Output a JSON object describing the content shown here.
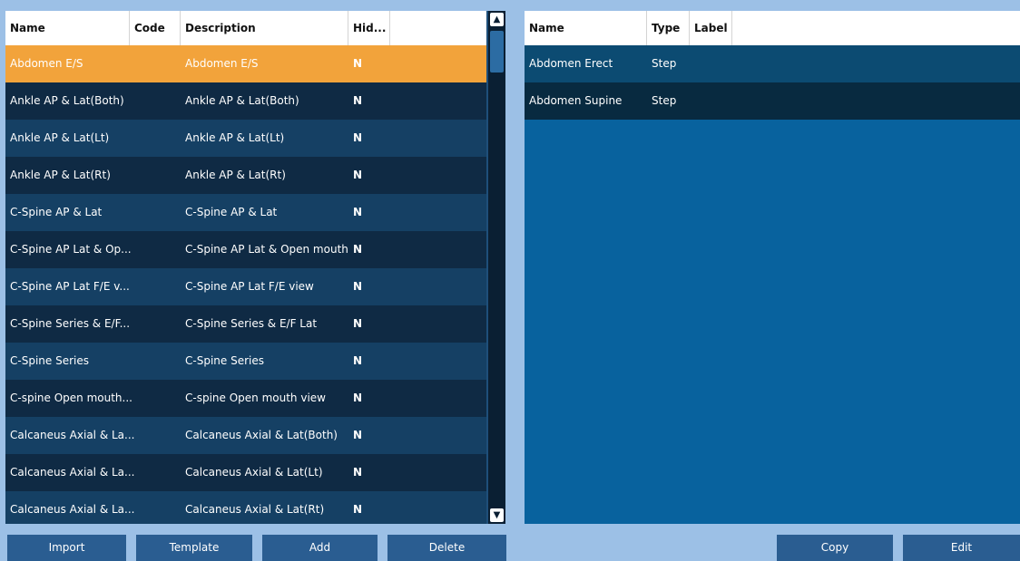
{
  "left_table": {
    "columns": [
      "Name",
      "Code",
      "Description",
      "Hid..."
    ],
    "rows": [
      {
        "name": "Abdomen E/S",
        "code": "",
        "description": "Abdomen E/S",
        "hidden": "N"
      },
      {
        "name": "Ankle AP & Lat(Both)",
        "code": "",
        "description": "Ankle AP & Lat(Both)",
        "hidden": "N"
      },
      {
        "name": "Ankle AP & Lat(Lt)",
        "code": "",
        "description": "Ankle AP & Lat(Lt)",
        "hidden": "N"
      },
      {
        "name": "Ankle AP & Lat(Rt)",
        "code": "",
        "description": "Ankle AP & Lat(Rt)",
        "hidden": "N"
      },
      {
        "name": "C-Spine AP & Lat",
        "code": "",
        "description": "C-Spine AP & Lat",
        "hidden": "N"
      },
      {
        "name": "C-Spine AP Lat & Op...",
        "code": "",
        "description": "C-Spine AP Lat & Open mouth",
        "hidden": "N"
      },
      {
        "name": "C-Spine AP Lat F/E v...",
        "code": "",
        "description": "C-Spine AP Lat F/E view",
        "hidden": "N"
      },
      {
        "name": "C-Spine Series & E/F...",
        "code": "",
        "description": "C-Spine Series & E/F Lat",
        "hidden": "N"
      },
      {
        "name": "C-Spine Series",
        "code": "",
        "description": "C-Spine Series",
        "hidden": "N"
      },
      {
        "name": "C-spine Open mouth...",
        "code": "",
        "description": "C-spine Open mouth view",
        "hidden": "N"
      },
      {
        "name": "Calcaneus Axial & La...",
        "code": "",
        "description": "Calcaneus Axial & Lat(Both)",
        "hidden": "N"
      },
      {
        "name": "Calcaneus Axial & La...",
        "code": "",
        "description": "Calcaneus Axial & Lat(Lt)",
        "hidden": "N"
      },
      {
        "name": "Calcaneus Axial & La...",
        "code": "",
        "description": "Calcaneus Axial & Lat(Rt)",
        "hidden": "N"
      }
    ],
    "selected_index": 0
  },
  "right_table": {
    "columns": [
      "Name",
      "Type",
      "Label"
    ],
    "rows": [
      {
        "name": "Abdomen Erect",
        "type": "Step",
        "label": ""
      },
      {
        "name": "Abdomen Supine",
        "type": "Step",
        "label": ""
      }
    ]
  },
  "buttons": {
    "import": "Import",
    "template": "Template",
    "add": "Add",
    "delete": "Delete",
    "copy": "Copy",
    "edit": "Edit"
  },
  "scrollbar": {
    "up_icon": "▲",
    "down_icon": "▼",
    "position": 0.0
  },
  "colors": {
    "selected_row": "#f2a33b",
    "dark_row": "#0f2a44",
    "mid_row": "#154064",
    "button": "#2a5d91",
    "background": "#9cc0e6"
  }
}
